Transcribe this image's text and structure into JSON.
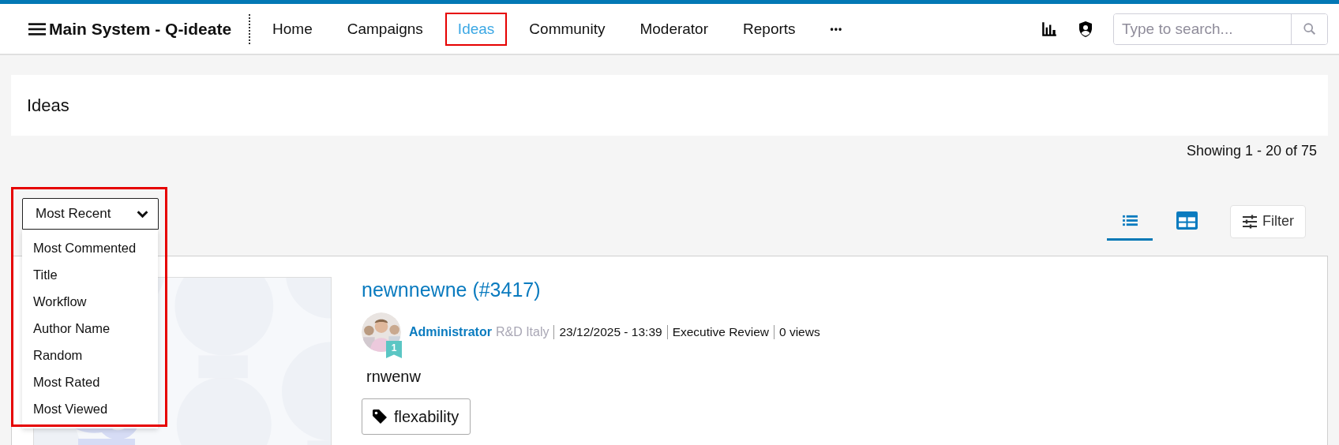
{
  "header": {
    "title": "Main System - Q-ideate",
    "nav": [
      {
        "label": "Home",
        "selected": false,
        "highlighted": false
      },
      {
        "label": "Campaigns",
        "selected": false,
        "highlighted": false
      },
      {
        "label": "Ideas",
        "selected": true,
        "highlighted": true
      },
      {
        "label": "Community",
        "selected": false,
        "highlighted": false
      },
      {
        "label": "Moderator",
        "selected": false,
        "highlighted": false
      },
      {
        "label": "Reports",
        "selected": false,
        "highlighted": false
      }
    ],
    "more": "•••",
    "search": {
      "placeholder": "Type to search..."
    }
  },
  "page_title": "Ideas",
  "showing": "Showing 1 - 20 of 75",
  "sort": {
    "value": "Most Recent",
    "expanded": true,
    "highlighted": true,
    "options": [
      "Most Commented",
      "Title",
      "Workflow",
      "Author Name",
      "Random",
      "Most Rated",
      "Most Viewed"
    ]
  },
  "views": [
    {
      "kind": "list",
      "selected": true
    },
    {
      "kind": "grid",
      "selected": false
    }
  ],
  "filter": "Filter",
  "ideas": [
    {
      "title": "newnnewne (#3417)",
      "author": "Administrator",
      "group": "R&D Italy",
      "date": "23/12/2025 - 13:39",
      "stage": "Executive Review",
      "views": "0 views",
      "rank": "1",
      "body": "rnwenw",
      "tags": [
        "flexability"
      ]
    }
  ]
}
